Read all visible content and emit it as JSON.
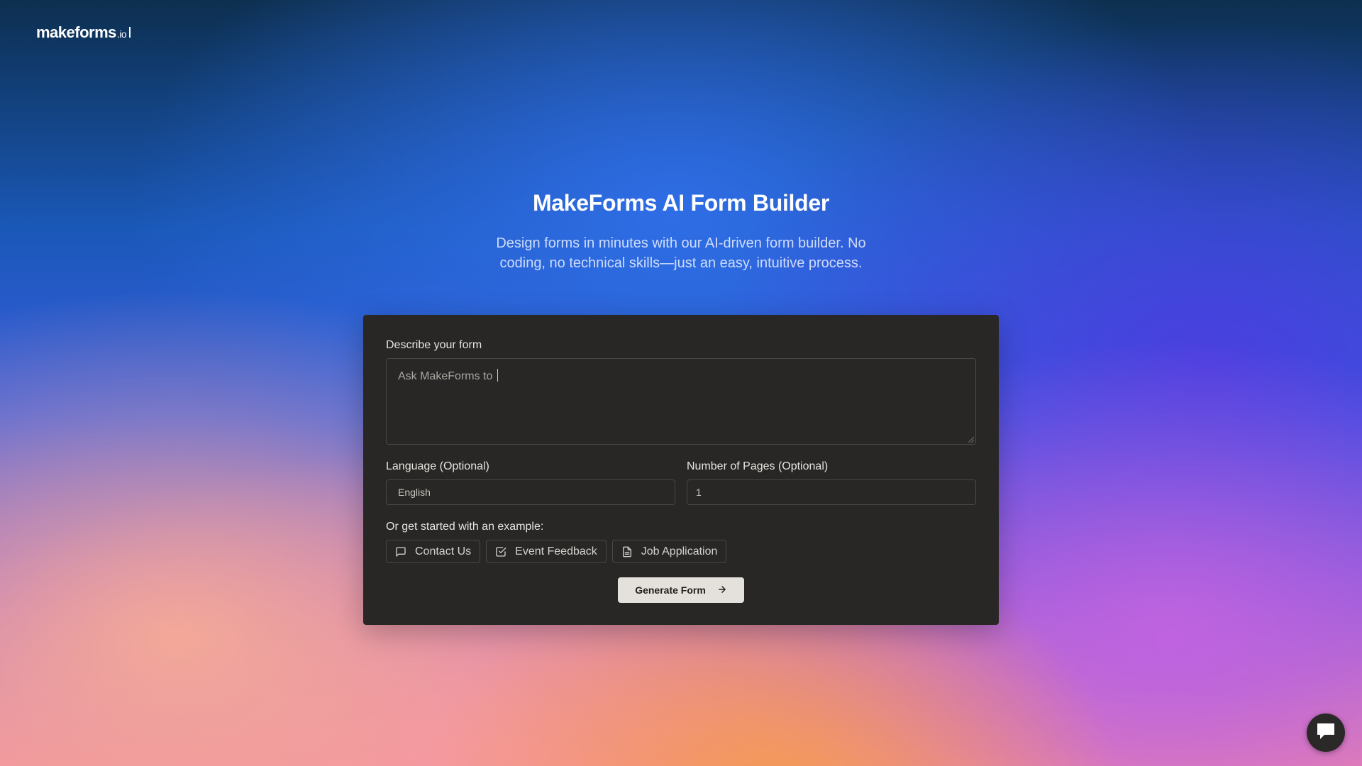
{
  "brand": {
    "name": "makeforms",
    "tld": ".io"
  },
  "hero": {
    "title": "MakeForms AI Form Builder",
    "subtitle": "Design forms in minutes with our AI-driven form builder. No coding, no technical skills—just an easy, intuitive process."
  },
  "form": {
    "describe_label": "Describe your form",
    "describe_placeholder": "Ask MakeForms to ",
    "language_label": "Language (Optional)",
    "language_value": "English",
    "pages_label": "Number of Pages (Optional)",
    "pages_value": "1",
    "examples_label": "Or get started with an example:",
    "examples": [
      {
        "label": "Contact Us",
        "icon": "message-square-icon"
      },
      {
        "label": "Event Feedback",
        "icon": "check-square-icon"
      },
      {
        "label": "Job Application",
        "icon": "file-text-icon"
      }
    ],
    "generate_label": "Generate Form"
  },
  "chat_widget": {
    "icon": "chat-bubble-icon"
  },
  "colors": {
    "card_bg": "#282725",
    "button_bg": "#e4e1dc",
    "text_light": "#ffffff"
  }
}
